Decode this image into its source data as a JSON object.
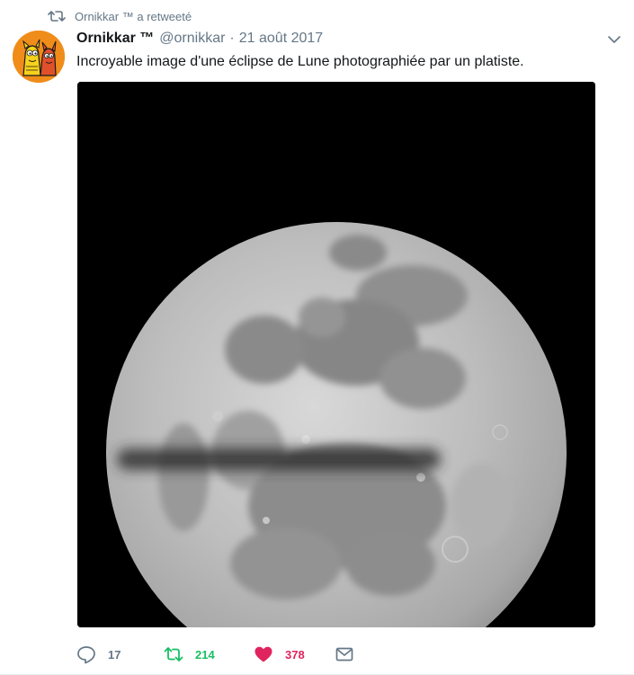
{
  "retweet_context": {
    "user": "Ornikkar ™",
    "action": " a retweeté"
  },
  "tweet": {
    "fullname": "Ornikkar ™",
    "username": "@ornikkar",
    "separator": "·",
    "date": "21 août 2017",
    "text": "Incroyable image d'une éclipse de Lune photographiée par un platiste."
  },
  "actions": {
    "reply_count": "17",
    "retweet_count": "214",
    "like_count": "378"
  },
  "colors": {
    "retweet_active": "#17bf63",
    "like_active": "#e0245e",
    "secondary_text": "#657786",
    "avatar_bg": "#f08c1a"
  },
  "icons": {
    "retweet_context": "retweet-icon",
    "caret": "chevron-down-icon",
    "reply": "reply-icon",
    "retweet": "retweet-icon",
    "like": "heart-icon",
    "message": "envelope-icon"
  }
}
